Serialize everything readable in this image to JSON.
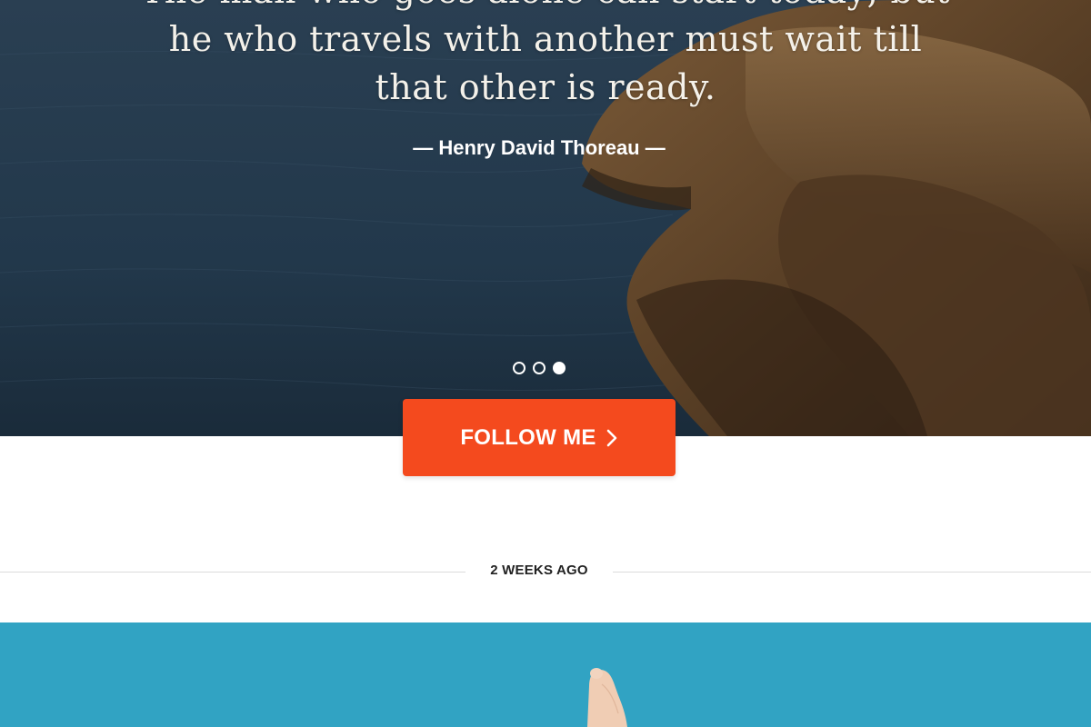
{
  "hero": {
    "quote_line1": "The man who goes alone can start today; but",
    "quote_line2": "he who travels with another must wait till",
    "quote_line3": "that other is ready.",
    "attribution": "— Henry David Thoreau —",
    "slider": {
      "count": 3,
      "active_index": 2
    }
  },
  "cta": {
    "label": "FOLLOW ME",
    "icon": "chevron-right-icon",
    "color": "#f44a1e"
  },
  "post": {
    "date_label": "2 WEEKS AGO",
    "image_background": "#31a3c3"
  }
}
